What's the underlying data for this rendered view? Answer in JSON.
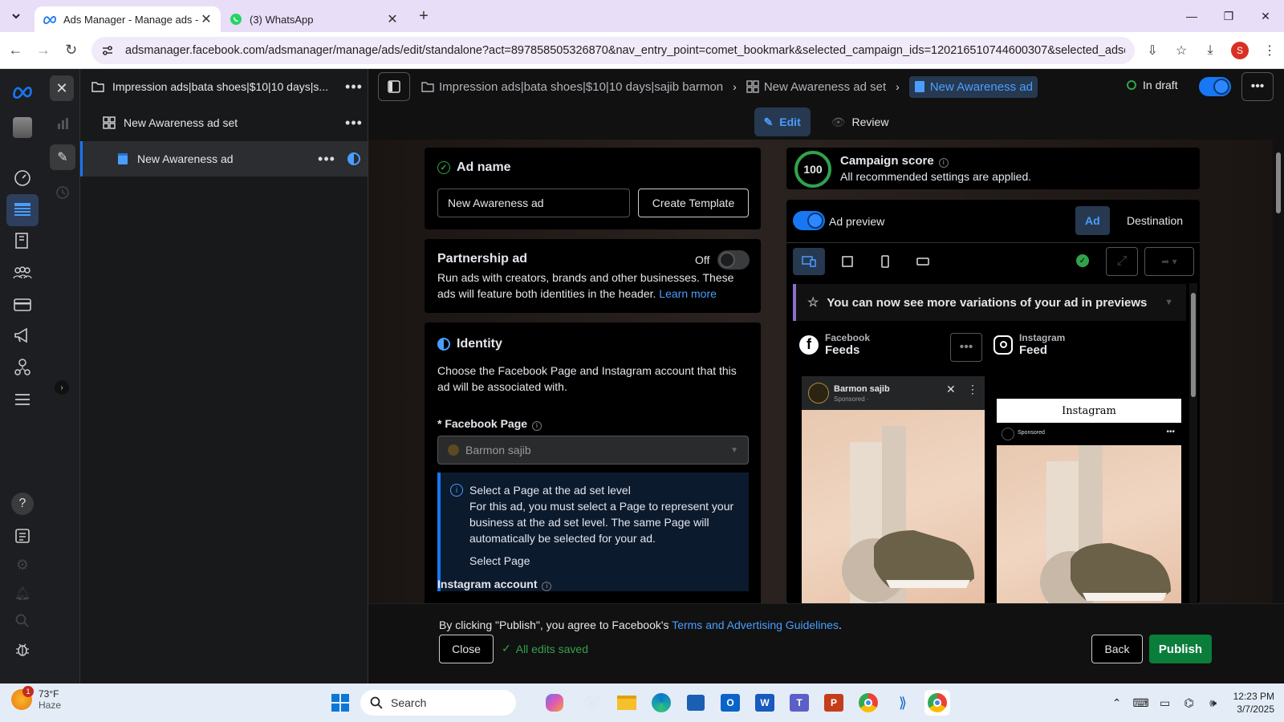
{
  "browser": {
    "tabs": [
      {
        "title": "Ads Manager - Manage ads - C",
        "active": true
      },
      {
        "title": "(3) WhatsApp",
        "active": false
      }
    ],
    "url": "adsmanager.facebook.com/adsmanager/manage/ads/edit/standalone?act=897858505326870&nav_entry_point=comet_bookmark&selected_campaign_ids=120216510744600307&selected_adset_ids=...",
    "profile_initial": "S"
  },
  "tree": {
    "campaign": "Impression ads|bata shoes|$10|10 days|s...",
    "adset": "New Awareness ad set",
    "ad": "New Awareness ad"
  },
  "topbar": {
    "crumb_campaign": "Impression ads|bata shoes|$10|10 days|sajib barmon",
    "crumb_adset": "New Awareness ad set",
    "crumb_ad": "New Awareness ad",
    "status": "In draft"
  },
  "modes": {
    "edit": "Edit",
    "review": "Review"
  },
  "ad_name": {
    "title": "Ad name",
    "value": "New Awareness ad",
    "create_template": "Create Template"
  },
  "partnership": {
    "title": "Partnership ad",
    "toggle_label": "Off",
    "desc": "Run ads with creators, brands and other businesses. These ads will feature both identities in the header.",
    "learn_more": "Learn more"
  },
  "identity": {
    "title": "Identity",
    "desc": "Choose the Facebook Page and Instagram account that this ad will be associated with.",
    "fb_page_label": "* Facebook Page",
    "fb_page_value": "Barmon sajib",
    "info_title": "Select a Page at the ad set level",
    "info_body": "For this ad, you must select a Page to represent your business at the ad set level. The same Page will automatically be selected for your ad.",
    "info_link": "Select Page",
    "ig_label": "Instagram account"
  },
  "score": {
    "value": "100",
    "title": "Campaign score",
    "subtitle": "All recommended settings are applied."
  },
  "preview": {
    "label": "Ad preview",
    "tab_ad": "Ad",
    "tab_destination": "Destination",
    "variation_banner": "You can now see more variations of your ad in previews",
    "fb_small": "Facebook",
    "fb_large": "Feeds",
    "ig_small": "Instagram",
    "ig_large": "Feed",
    "fb_page_name": "Barmon sajib",
    "fb_sponsored": "Sponsored · ",
    "ig_logo": "Instagram",
    "ig_sponsored": "Sponsored"
  },
  "footer": {
    "terms_prefix": "By clicking \"Publish\", you agree to Facebook's",
    "terms_link": "Terms and Advertising Guidelines",
    "terms_suffix": ".",
    "close": "Close",
    "saved": "All edits saved",
    "back": "Back",
    "publish": "Publish"
  },
  "taskbar": {
    "temp": "73°F",
    "weather": "Haze",
    "weather_badge": "1",
    "search": "Search",
    "time": "12:23 PM",
    "date": "3/7/2025"
  },
  "colors": {
    "accent": "#1877f2",
    "publish_green": "#0a7d3b",
    "score_green": "#31a24c"
  }
}
